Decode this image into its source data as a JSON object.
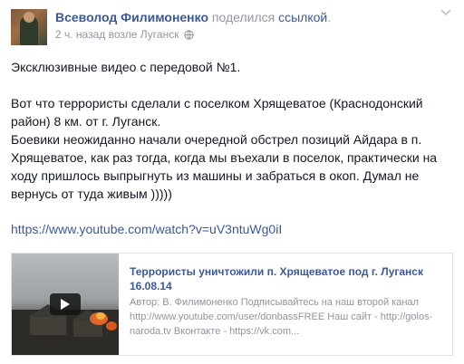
{
  "post": {
    "author": "Всеволод Филимоненко",
    "shared_text": "поделился",
    "shared_link_word": "ссылкой",
    "shared_suffix": ".",
    "time": "2 ч. назад",
    "location_prefix": " возле ",
    "location": "Луганск",
    "icons": {
      "privacy": "globe-icon",
      "menu": "chevron-down-icon",
      "video": "play-icon"
    },
    "paragraph1": "Эксклюзивные видео с передовой №1.",
    "paragraph2_lines": [
      "Вот что террористы сделали с поселком Хрящеватое (Краснодонский район) 8 км. от г. Луганск.",
      "Боевики неожиданно начали очередной обстрел позиций Айдара в п. Хрящеватое, как раз тогда, когда мы въехали в поселок, практически на ходу пришлось выпрыгнуть из машины и забраться в окоп. Думал не вернусь от туда живым )))))"
    ],
    "url": "https://www.youtube.com/watch?v=uV3ntuWg0iI"
  },
  "card": {
    "title": "Террористы уничтожили п. Хрящеватое под г. Луганск 16.08.14",
    "description": "Автор: В. Филимоненко Подписывайтесь на наш второй канал http://www.youtube.com/user/donbassFREE Наш сайт - http://golos-naroda.tv Вконтакте - https://vk.com..."
  },
  "colors": {
    "link": "#3b5998",
    "meta": "#9197a3",
    "text": "#141823"
  }
}
